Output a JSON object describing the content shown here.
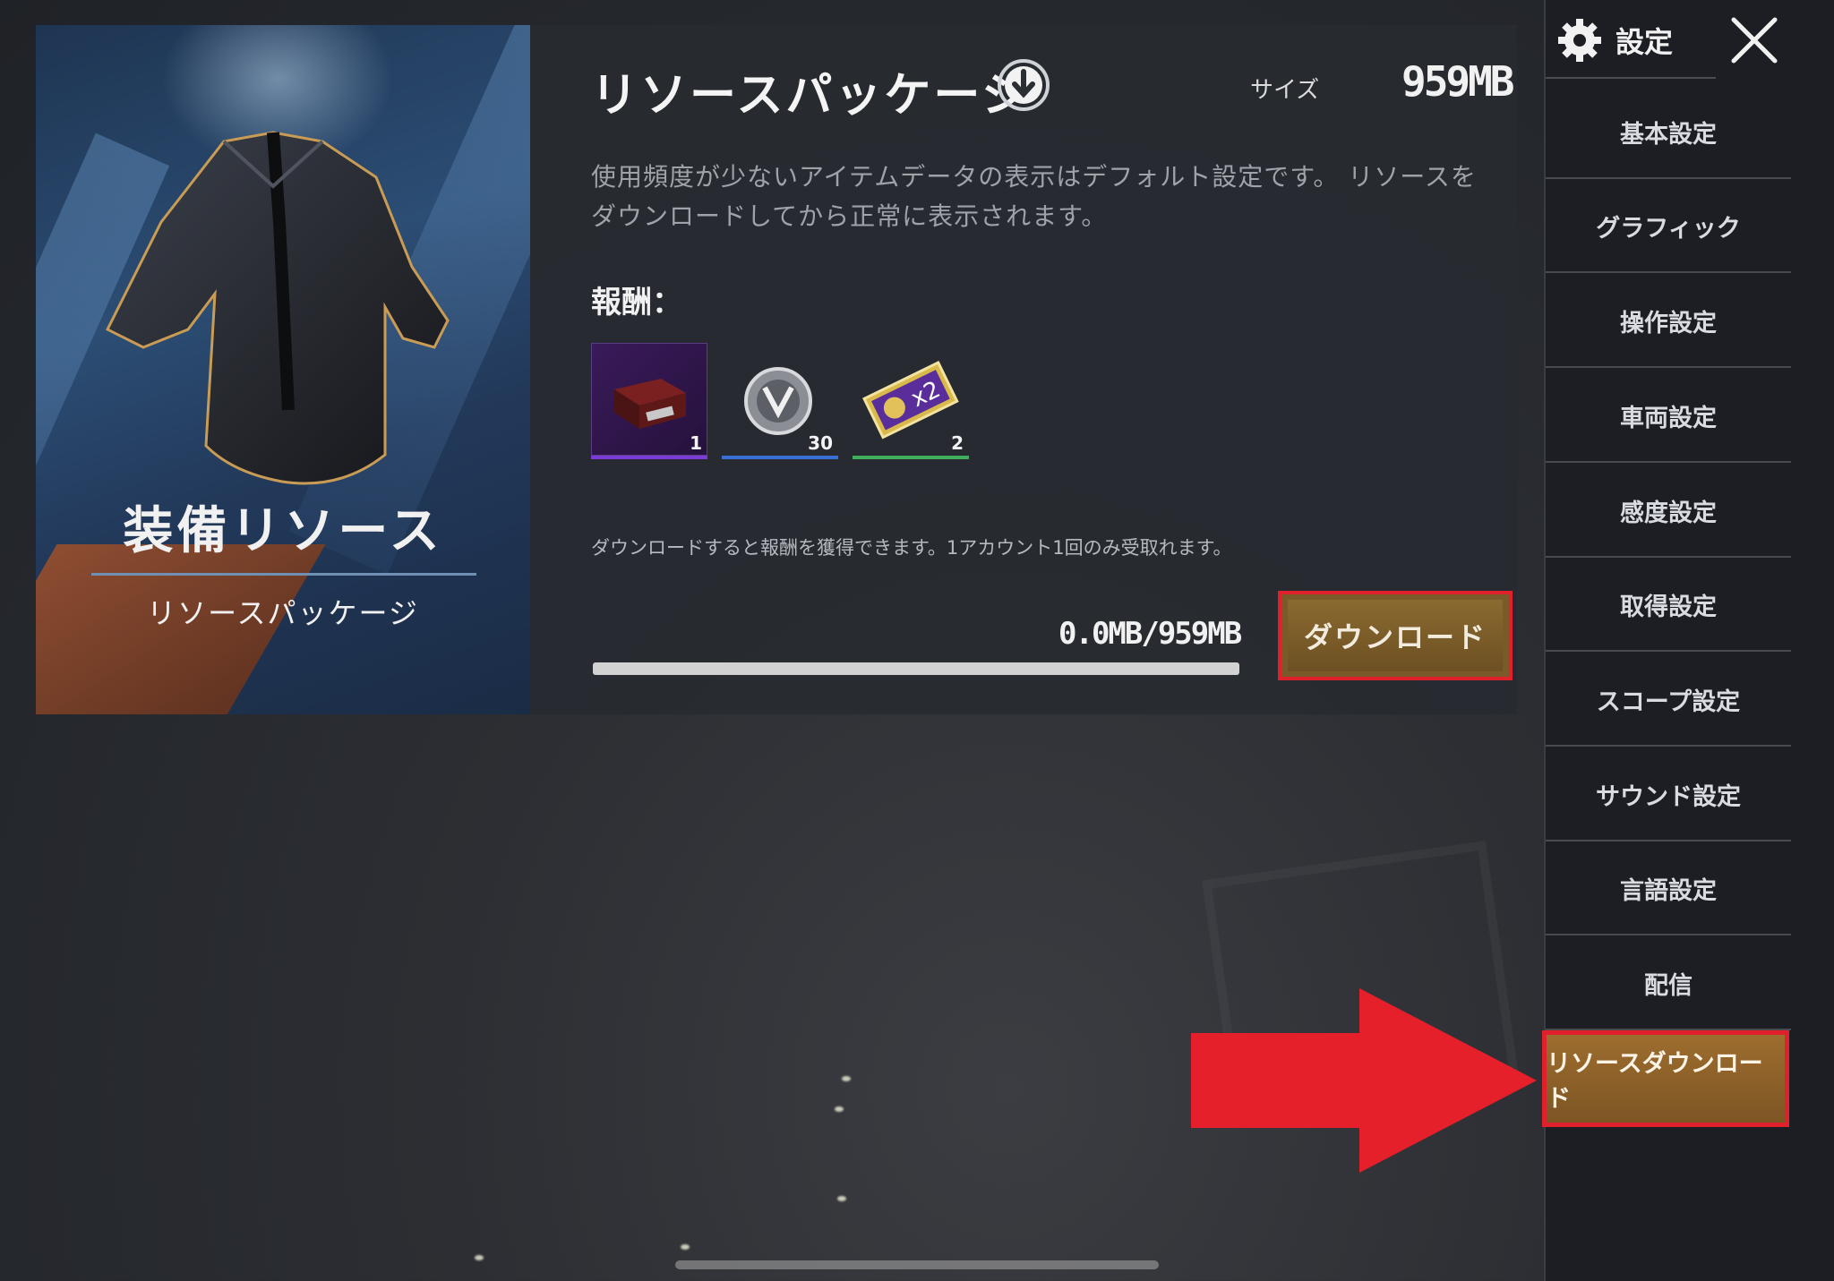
{
  "hero": {
    "title": "装備リソース",
    "subtitle": "リソースパッケージ"
  },
  "package": {
    "title": "リソースパッケージ",
    "size_label": "サイズ",
    "size_value": "959MB",
    "description": "使用頻度が少ないアイテムデータの表示はデフォルト設定です。 リソースをダウンロードしてから正常に表示されます。",
    "reward_label": "報酬：",
    "rewards": [
      {
        "icon": "supply-crate-icon",
        "count": "1",
        "bar_color": "#7a3bd6"
      },
      {
        "icon": "badge-emblem-icon",
        "count": "30",
        "bar_color": "#3a6fd6"
      },
      {
        "icon": "x2-coupon-icon",
        "count": "2",
        "bar_color": "#3fae5a"
      }
    ],
    "note": "ダウンロードすると報酬を獲得できます。1アカウント1回のみ受取れます。",
    "progress_text": "0.0MB/959MB",
    "progress_fraction": 0,
    "download_button": "ダウンロード"
  },
  "sidebar": {
    "header": "設定",
    "items": [
      {
        "label": "基本設定"
      },
      {
        "label": "グラフィック"
      },
      {
        "label": "操作設定"
      },
      {
        "label": "車両設定"
      },
      {
        "label": "感度設定"
      },
      {
        "label": "取得設定"
      },
      {
        "label": "スコープ設定"
      },
      {
        "label": "サウンド設定"
      },
      {
        "label": "言語設定"
      },
      {
        "label": "配信"
      },
      {
        "label": "リソースダウンロード",
        "active": true
      }
    ]
  },
  "colors": {
    "accent_gold": "#8a6a30",
    "highlight_red": "#e0202a",
    "arrow_red": "#e6202a"
  }
}
